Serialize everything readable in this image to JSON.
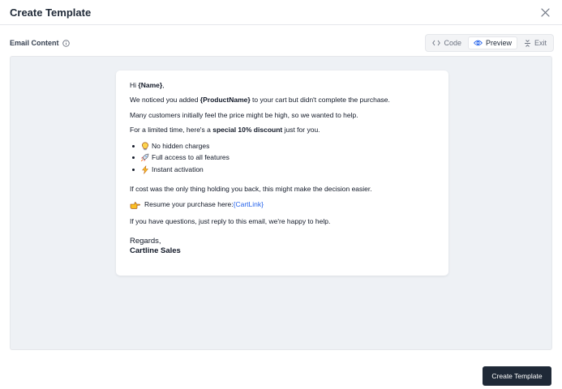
{
  "modal": {
    "title": "Create Template"
  },
  "content": {
    "label": "Email Content",
    "modes": {
      "code": "Code",
      "preview": "Preview",
      "exit": "Exit"
    }
  },
  "email": {
    "greeting_prefix": "Hi ",
    "greeting_name": "{Name}",
    "greeting_suffix": ",",
    "line1_prefix": "We noticed you added ",
    "line1_product": "{ProductName}",
    "line1_suffix": " to your cart but didn't complete the purchase.",
    "line2": "Many customers initially feel the price might be high, so we wanted to help.",
    "line3_prefix": "For a limited time, here's a ",
    "line3_bold": "special 10% discount",
    "line3_suffix": " just for you.",
    "bullets": [
      {
        "icon": "lightbulb-icon",
        "text": "No hidden charges"
      },
      {
        "icon": "rocket-icon",
        "text": "Full access to all features"
      },
      {
        "icon": "lightning-icon",
        "text": "Instant activation"
      }
    ],
    "line4": "If cost was the only thing holding you back, this might make the decision easier.",
    "resume_prefix": "Resume your purchase here: ",
    "resume_link": "{CartLink}",
    "line5": "If you have questions, just reply to this email, we're happy to help.",
    "regards": "Regards,",
    "signature": "Cartline Sales"
  },
  "footer": {
    "create_button": "Create Template"
  },
  "colors": {
    "primary_button": "#1f2937",
    "link": "#2563eb",
    "preview_bg": "#eef1f5"
  }
}
